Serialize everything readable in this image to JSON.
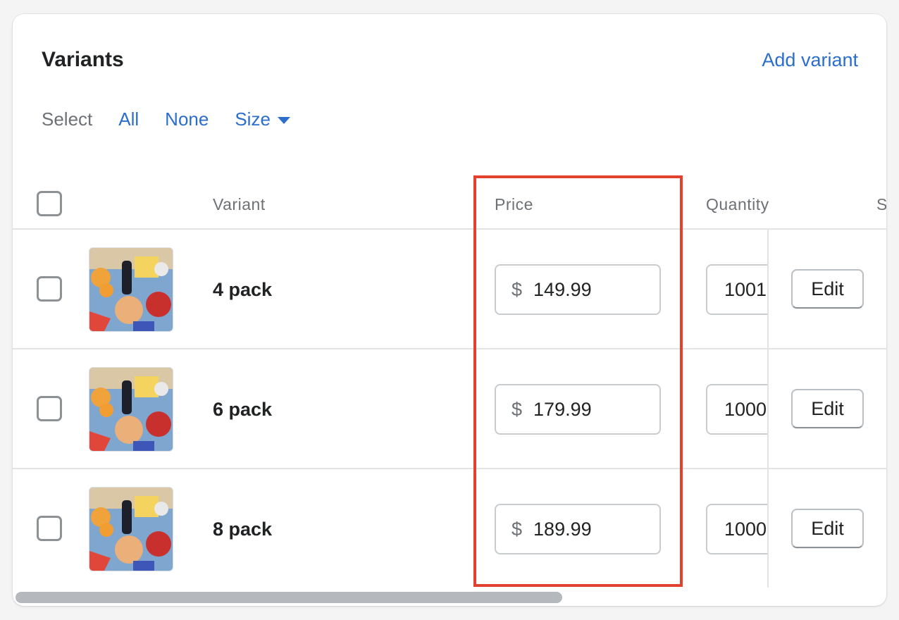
{
  "card": {
    "title": "Variants",
    "add_variant_label": "Add variant"
  },
  "select": {
    "label": "Select",
    "all": "All",
    "none": "None",
    "size": "Size"
  },
  "table": {
    "headers": {
      "variant": "Variant",
      "price": "Price",
      "quantity": "Quantity",
      "cut_off": "S"
    },
    "rows": [
      {
        "name": "4 pack",
        "currency": "$",
        "price": "149.99",
        "quantity": "1001",
        "edit": "Edit"
      },
      {
        "name": "6 pack",
        "currency": "$",
        "price": "179.99",
        "quantity": "1000",
        "edit": "Edit"
      },
      {
        "name": "8 pack",
        "currency": "$",
        "price": "189.99",
        "quantity": "1000",
        "edit": "Edit"
      }
    ]
  },
  "colors": {
    "link": "#2c6ecb",
    "highlight": "#e2412e",
    "border": "#e1e3e5"
  },
  "icons": {
    "size_dropdown": "caret-down-icon",
    "thumbnail": "product-image"
  }
}
